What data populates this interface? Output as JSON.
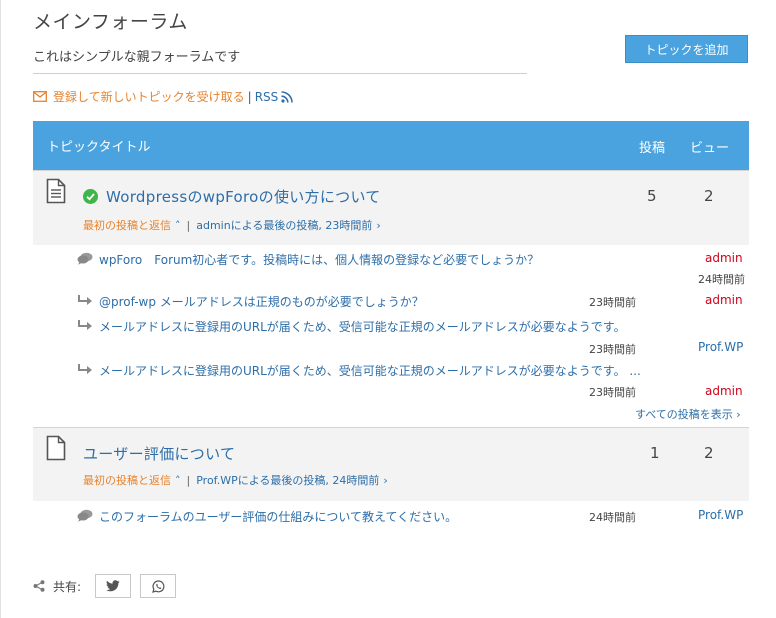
{
  "forum": {
    "title": "メインフォーラム",
    "subtitle": "これはシンプルな親フォーラムです",
    "add_topic_label": "トピックを追加"
  },
  "subscribe": {
    "link_label": "登録して新しいトピックを受け取る",
    "separator": "|",
    "rss_label": "RSS"
  },
  "header": {
    "topic_title": "トピックタイトル",
    "posts": "投稿",
    "views": "ビュー"
  },
  "topics": [
    {
      "title": "WordpressのwpForoの使い方について",
      "first_post_label": "最初の投稿と返信",
      "separator": "|",
      "last_post": "adminによる最後の投稿, 23時間前",
      "posts": "5",
      "views": "2",
      "solved": true,
      "replies": [
        {
          "text": "wpForo　Forum初心者です。投稿時には、個人情報の登録など必要でしょうか？",
          "time": "24時間前",
          "author": "admin",
          "icon": "comments-icon"
        },
        {
          "text": "@prof-wp メールアドレスは正規のものが必要でしょうか？",
          "time": "23時間前",
          "author": "admin",
          "icon": "reply-arrow-icon"
        },
        {
          "text": "メールアドレスに登録用のURLが届くため、受信可能な正規のメールアドレスが必要なようです。",
          "time": "23時間前",
          "author": "Prof.WP",
          "icon": "reply-arrow-icon"
        },
        {
          "text": "メールアドレスに登録用のURLが届くため、受信可能な正規のメールアドレスが必要なようです。 ...",
          "time": "23時間前",
          "author": "admin",
          "icon": "reply-arrow-icon"
        }
      ],
      "all_posts_label": "すべての投稿を表示"
    },
    {
      "title": "ユーザー評価について",
      "first_post_label": "最初の投稿と返信",
      "separator": "|",
      "last_post": "Prof.WPによる最後の投稿, 24時間前",
      "posts": "1",
      "views": "2",
      "solved": false,
      "replies": [
        {
          "text": "このフォーラムのユーザー評価の仕組みについて教えてください。",
          "time": "24時間前",
          "author": "Prof.WP",
          "icon": "comments-icon"
        }
      ]
    }
  ],
  "share": {
    "label": "共有:"
  },
  "colors": {
    "accent_blue": "#4aa3df",
    "link_blue": "#2d6ea8",
    "orange": "#e6832e",
    "admin_red": "#d0021b"
  }
}
